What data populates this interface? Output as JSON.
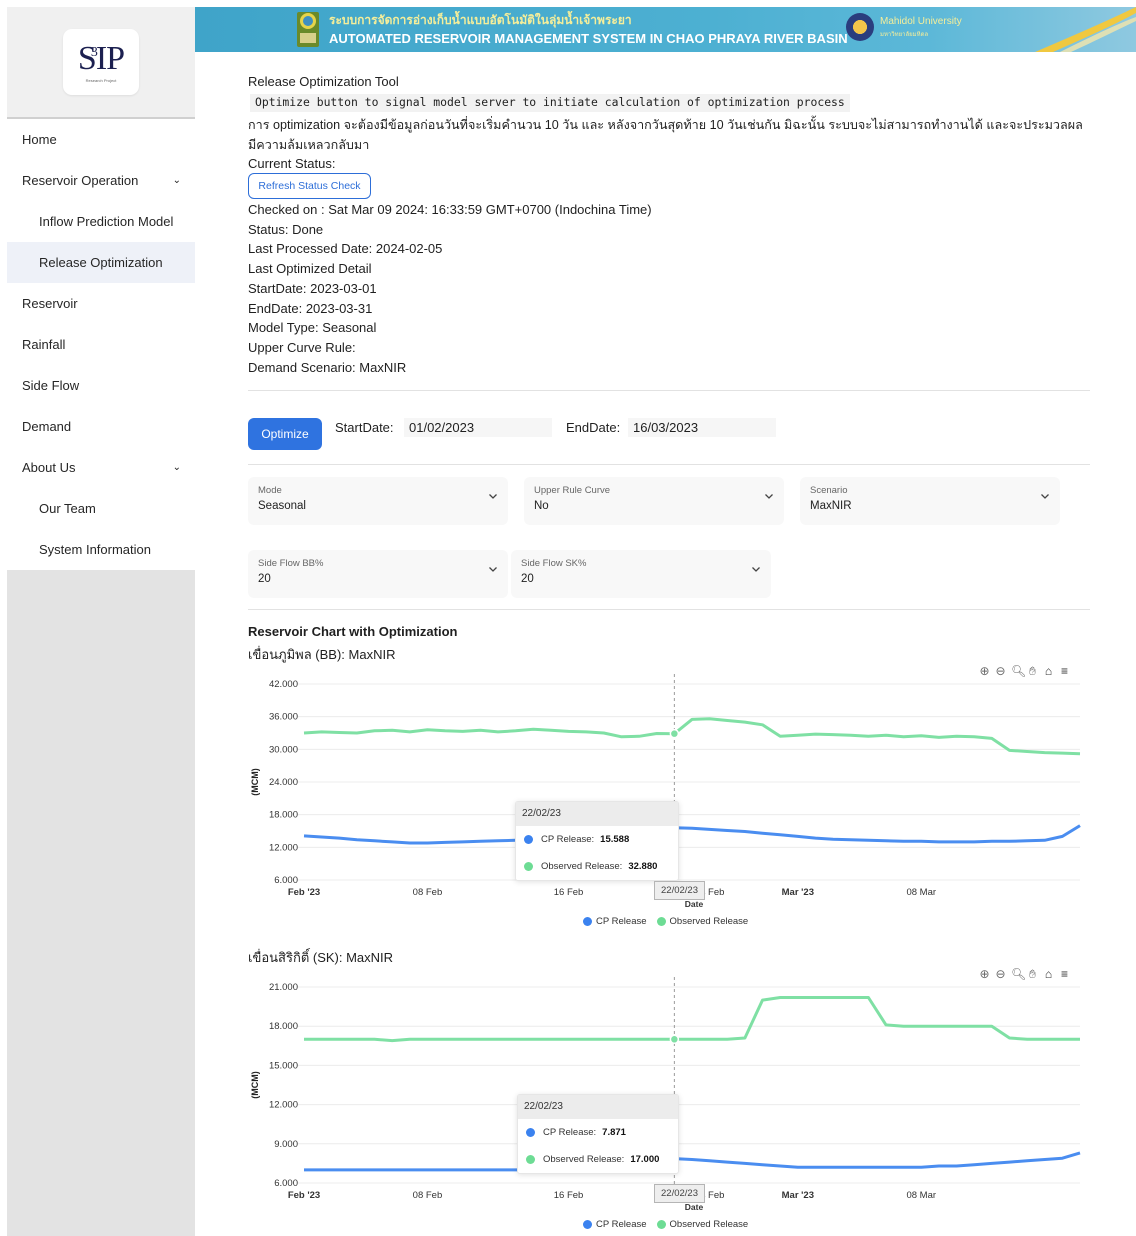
{
  "colors": {
    "cp_release": "#4a8df0",
    "observed_release": "#7fe0a4",
    "accent": "#2f73e0"
  },
  "logo": {
    "text": "SIP",
    "superscript": "3",
    "subtitle": "Research Project"
  },
  "sidebar": {
    "items": [
      {
        "label": "Home",
        "sub": false
      },
      {
        "label": "Reservoir Operation",
        "sub": false,
        "expandable": true
      },
      {
        "label": "Inflow Prediction Model",
        "sub": true
      },
      {
        "label": "Release Optimization",
        "sub": true,
        "active": true
      },
      {
        "label": "Reservoir",
        "sub": false
      },
      {
        "label": "Rainfall",
        "sub": false
      },
      {
        "label": "Side Flow",
        "sub": false
      },
      {
        "label": "Demand",
        "sub": false
      },
      {
        "label": "About Us",
        "sub": false,
        "expandable": true
      },
      {
        "label": "Our Team",
        "sub": true
      },
      {
        "label": "System Information",
        "sub": true
      }
    ]
  },
  "header": {
    "title_th": "ระบบการจัดการอ่างเก็บน้ำแบบอัตโนมัติในลุ่มน้ำเจ้าพระยา",
    "title_en": "AUTOMATED RESERVOIR MANAGEMENT SYSTEM IN CHAO PHRAYA RIVER BASIN",
    "university": "Mahidol University",
    "university_th": "มหาวิทยาลัยมหิดล"
  },
  "main": {
    "tool_title": "Release Optimization Tool",
    "code_hint": "Optimize button to signal model server to initiate calculation of optimization process",
    "notice_th": "การ optimization จะต้องมีข้อมูลก่อนวันที่จะเริ่มคำนวน 10 วัน และ หลังจากวันสุดท้าย 10 วันเช่นกัน มิฉะนั้น ระบบจะไม่สามารถทำงานได้ และจะประมวลผลมีความล้มเหลวกลับมา",
    "current_status_label": "Current Status:",
    "refresh_button": "Refresh Status Check",
    "status_lines": {
      "checked_on": "Checked on : Sat Mar 09 2024: 16:33:59 GMT+0700 (Indochina Time)",
      "status": "Status: Done",
      "last_processed": "Last Processed Date: 2024-02-05",
      "last_optimized": "Last Optimized Detail",
      "start_date": "StartDate: 2023-03-01",
      "end_date": "EndDate: 2023-03-31",
      "model_type": "Model Type: Seasonal",
      "upper_curve": "Upper Curve Rule:",
      "demand_scenario": "Demand Scenario: MaxNIR"
    },
    "optimize_button": "Optimize",
    "start_label": "StartDate:",
    "start_value": "01/02/2023",
    "end_label": "EndDate:",
    "end_value": "16/03/2023",
    "selects": {
      "mode": {
        "label": "Mode",
        "value": "Seasonal"
      },
      "upper_rule": {
        "label": "Upper Rule Curve",
        "value": "No"
      },
      "scenario": {
        "label": "Scenario",
        "value": "MaxNIR"
      },
      "sideflow_bb": {
        "label": "Side Flow BB%",
        "value": "20"
      },
      "sideflow_sk": {
        "label": "Side Flow SK%",
        "value": "20"
      }
    },
    "chart_heading": "Reservoir Chart with Optimization",
    "chart1_sub": "เขื่อนภูมิพล (BB): MaxNIR",
    "chart2_sub": "เขื่อนสิริกิติ์ (SK): MaxNIR",
    "tooltip1": {
      "date": "22/02/23",
      "cp_label": "CP Release:",
      "cp_value": "15.588",
      "obs_label": "Observed Release:",
      "obs_value": "32.880"
    },
    "tooltip2": {
      "date": "22/02/23",
      "cp_label": "CP Release:",
      "cp_value": "7.871",
      "obs_label": "Observed Release:",
      "obs_value": "17.000"
    },
    "xtip": "22/02/23",
    "legend": {
      "cp": "CP Release",
      "obs": "Observed Release"
    }
  },
  "chart_data": [
    {
      "type": "line",
      "title": "เขื่อนภูมิพล (BB): MaxNIR",
      "xlabel": "Date",
      "ylabel": "(MCM)",
      "ylim": [
        6,
        42
      ],
      "yticks": [
        "6.000",
        "12.000",
        "18.000",
        "24.000",
        "30.000",
        "36.000",
        "42.000"
      ],
      "xticks": [
        "Feb '23",
        "08 Feb",
        "16 Feb",
        "24 Feb",
        "Mar '23",
        "08 Mar"
      ],
      "x_start": "2023-02-01",
      "x_end": "2023-03-16",
      "series": [
        {
          "name": "CP Release",
          "values": [
            14.1,
            13.9,
            13.7,
            13.4,
            13.2,
            13.0,
            12.8,
            12.8,
            12.9,
            13.0,
            13.1,
            13.2,
            13.3,
            13.4,
            13.5,
            13.6,
            13.7,
            13.8,
            13.9,
            14.0,
            14.1,
            15.588,
            15.5,
            15.3,
            15.1,
            14.9,
            14.6,
            14.3,
            14.0,
            13.7,
            13.5,
            13.4,
            13.3,
            13.2,
            13.1,
            13.1,
            13.0,
            13.0,
            13.0,
            13.1,
            13.1,
            13.2,
            13.3,
            14.0,
            16.0
          ]
        },
        {
          "name": "Observed Release",
          "values": [
            33.0,
            33.2,
            33.1,
            33.0,
            33.4,
            33.5,
            33.2,
            33.6,
            33.4,
            33.3,
            33.5,
            33.2,
            33.4,
            33.7,
            33.5,
            33.3,
            33.2,
            33.0,
            32.3,
            32.4,
            32.9,
            32.88,
            35.5,
            35.6,
            35.3,
            35.0,
            34.5,
            32.4,
            32.6,
            32.8,
            32.7,
            32.6,
            32.4,
            32.6,
            32.3,
            32.5,
            32.2,
            32.4,
            32.3,
            32.0,
            29.8,
            29.6,
            29.4,
            29.3,
            29.2
          ]
        }
      ]
    },
    {
      "type": "line",
      "title": "เขื่อนสิริกิติ์ (SK): MaxNIR",
      "xlabel": "Date",
      "ylabel": "(MCM)",
      "ylim": [
        6,
        21
      ],
      "yticks": [
        "6.000",
        "9.000",
        "12.000",
        "15.000",
        "18.000",
        "21.000"
      ],
      "xticks": [
        "Feb '23",
        "08 Feb",
        "16 Feb",
        "24 Feb",
        "Mar '23",
        "08 Mar"
      ],
      "x_start": "2023-02-01",
      "x_end": "2023-03-16",
      "series": [
        {
          "name": "CP Release",
          "values": [
            7.0,
            7.0,
            7.0,
            7.0,
            7.0,
            7.0,
            7.0,
            7.0,
            7.0,
            7.0,
            7.0,
            7.0,
            7.0,
            7.0,
            7.0,
            7.0,
            7.0,
            7.0,
            7.1,
            7.2,
            7.4,
            7.871,
            7.8,
            7.7,
            7.6,
            7.5,
            7.4,
            7.3,
            7.2,
            7.2,
            7.2,
            7.2,
            7.2,
            7.2,
            7.2,
            7.2,
            7.3,
            7.3,
            7.4,
            7.5,
            7.6,
            7.7,
            7.8,
            7.9,
            8.3
          ]
        },
        {
          "name": "Observed Release",
          "values": [
            17.0,
            17.0,
            17.0,
            17.0,
            17.0,
            16.9,
            17.0,
            17.0,
            17.0,
            17.0,
            17.0,
            17.0,
            17.0,
            17.0,
            17.0,
            17.0,
            17.0,
            17.0,
            17.0,
            17.0,
            17.0,
            17.0,
            17.0,
            17.0,
            17.0,
            17.1,
            20.0,
            20.2,
            20.2,
            20.2,
            20.2,
            20.2,
            20.2,
            18.1,
            18.0,
            18.0,
            18.0,
            18.0,
            18.0,
            18.0,
            17.1,
            17.0,
            17.0,
            17.0,
            17.0
          ]
        }
      ]
    }
  ]
}
